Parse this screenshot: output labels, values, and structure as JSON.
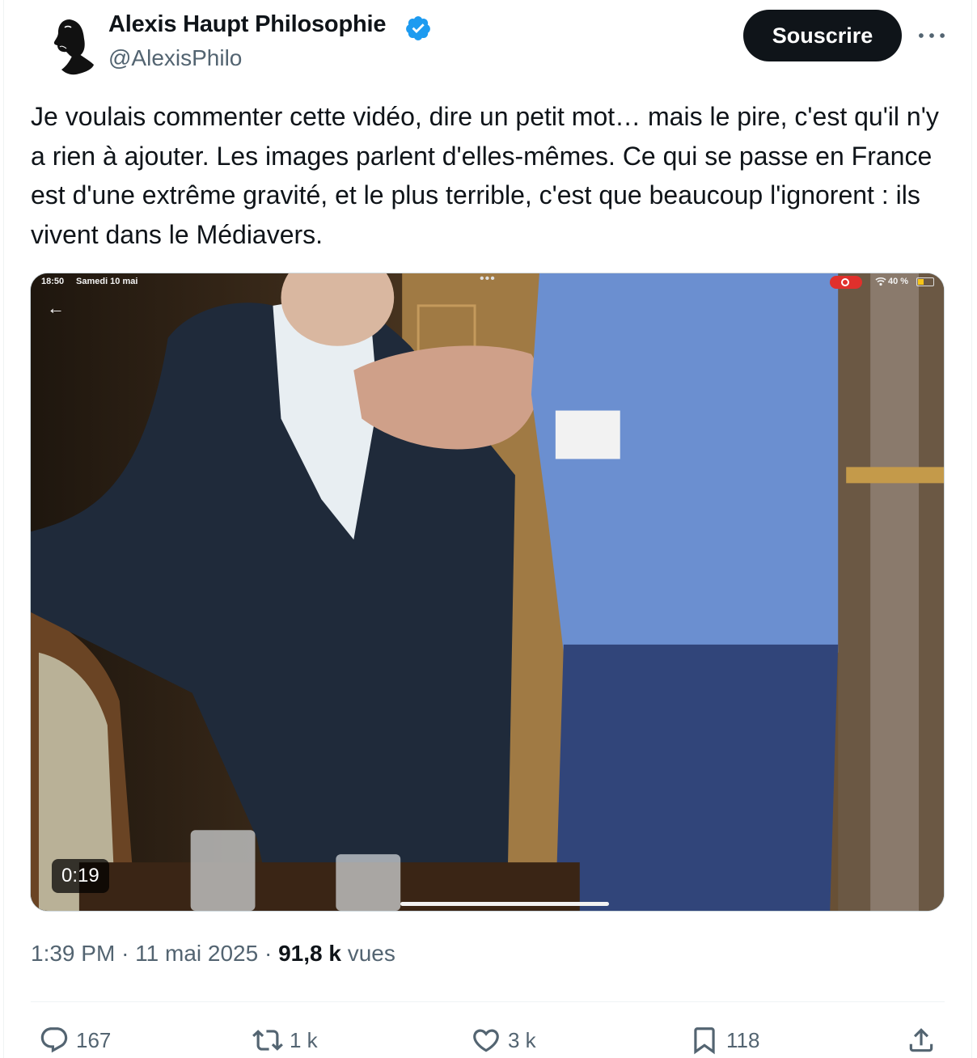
{
  "author": {
    "display_name": "Alexis Haupt Philosophie",
    "handle": "@AlexisPhilo",
    "verified_color": "#1d9bf0"
  },
  "header": {
    "subscribe_label": "Souscrire",
    "more_icon": "more-horizontal-icon"
  },
  "tweet": {
    "text": "Je voulais commenter cette vidéo, dire un petit mot… mais le pire, c'est qu'il n'y a rien à ajouter. Les images parlent d'elles-mêmes. Ce qui se passe en France est d'une extrême gravité, et le plus terrible, c'est que beaucoup l'ignorent : ils vivent dans le Médiavers."
  },
  "video": {
    "status_time": "18:50",
    "status_date": "Samedi 10 mai",
    "battery": "40 %",
    "battery_level": 0.4,
    "duration": "0:19",
    "back_icon": "back-arrow-icon"
  },
  "meta": {
    "time": "1:39 PM",
    "date": "11 mai 2025",
    "views_count": "91,8 k",
    "views_label": "vues"
  },
  "actions": {
    "replies": "167",
    "reposts": "1 k",
    "likes": "3 k",
    "bookmarks": "118"
  }
}
